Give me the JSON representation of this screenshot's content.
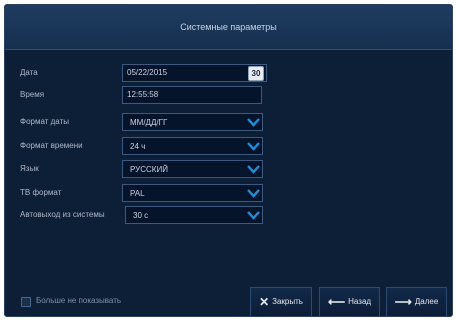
{
  "dialog": {
    "title": "Системные параметры"
  },
  "fields": {
    "date": {
      "label": "Дата",
      "value": "05/22/2015",
      "calendar_icon_text": "30"
    },
    "time": {
      "label": "Время",
      "value": "12:55:58"
    },
    "date_format": {
      "label": "Формат даты",
      "value": "ММ/ДД/ГГ"
    },
    "time_format": {
      "label": "Формат времени",
      "value": "24 ч"
    },
    "language": {
      "label": "Язык",
      "value": "РУССКИЙ"
    },
    "tv_format": {
      "label": "ТВ формат",
      "value": "PAL"
    },
    "auto_logout": {
      "label": "Автовыход из системы",
      "value": "30 с"
    }
  },
  "footer": {
    "dont_show_label": "Больше не показывать",
    "close_label": "Закрыть",
    "back_label": "Назад",
    "next_label": "Далее"
  },
  "icons": {
    "dropdown": "chevron-down-icon",
    "calendar": "calendar-icon",
    "close": "close-icon",
    "back": "arrow-left-icon",
    "next": "arrow-right-icon"
  },
  "colors": {
    "background": "#0d1e37",
    "accent": "#1d8fd8"
  }
}
